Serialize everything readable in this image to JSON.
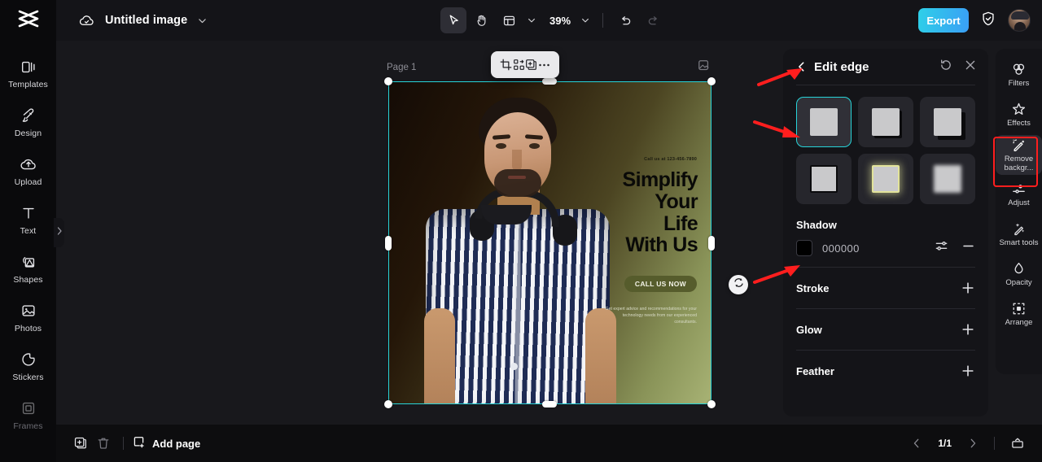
{
  "app": {
    "logo_icon": "capcut-logo-icon",
    "cloud_icon": "cloud-saved-icon",
    "document_title": "Untitled image",
    "title_caret_icon": "chevron-down-icon"
  },
  "toolbar": {
    "select_tool_icon": "cursor-arrow-icon",
    "hand_tool_icon": "hand-pan-icon",
    "layout_tool_icon": "layout-panel-icon",
    "layout_caret_icon": "chevron-down-icon",
    "zoom_level": "39%",
    "zoom_caret_icon": "chevron-down-icon",
    "undo_icon": "undo-arrow-icon",
    "redo_icon": "redo-arrow-icon",
    "export_label": "Export",
    "shield_icon": "shield-check-icon",
    "avatar_icon": "user-avatar"
  },
  "left_rail": {
    "items": [
      {
        "label": "Templates",
        "icon": "templates-icon",
        "dim": false
      },
      {
        "label": "Design",
        "icon": "design-brush-icon",
        "dim": false
      },
      {
        "label": "Upload",
        "icon": "upload-cloud-icon",
        "dim": false
      },
      {
        "label": "Text",
        "icon": "text-t-icon",
        "dim": false
      },
      {
        "label": "Shapes",
        "icon": "shapes-icon",
        "dim": false
      },
      {
        "label": "Photos",
        "icon": "photo-image-icon",
        "dim": false
      },
      {
        "label": "Stickers",
        "icon": "sticker-icon",
        "dim": false
      },
      {
        "label": "Frames",
        "icon": "frame-icon",
        "dim": true
      }
    ],
    "expander_icon": "chevron-right-icon"
  },
  "canvas": {
    "page_label": "Page 1",
    "float_toolbar": {
      "crop_icon": "crop-icon",
      "replace_icon": "replace-swap-icon",
      "duplicate_icon": "duplicate-add-icon",
      "more_icon": "more-horizontal-icon"
    },
    "layer_badge_icon": "layers-image-icon",
    "rotate_handle_icon": "rotate-icon",
    "poster": {
      "phone_text": "Call us at 123-456-7890",
      "headline_lines": [
        "Simplify",
        "Your",
        "Life",
        "With Us"
      ],
      "cta_label": "CALL US NOW",
      "paragraph": "Get expert advice and recommendations for your technology needs from our experienced consultants."
    }
  },
  "edit_panel": {
    "back_icon": "chevron-left-icon",
    "title": "Edit edge",
    "reset_icon": "reset-history-icon",
    "close_icon": "close-x-icon",
    "styles": [
      {
        "name": "style-none",
        "variant": "plain",
        "selected": true
      },
      {
        "name": "style-shadow-soft",
        "variant": "shadow-sm",
        "selected": false
      },
      {
        "name": "style-shadow-hard",
        "variant": "shadow-lg",
        "selected": false
      },
      {
        "name": "style-outline",
        "variant": "outline",
        "selected": false
      },
      {
        "name": "style-glow",
        "variant": "glow",
        "selected": false
      },
      {
        "name": "style-blur",
        "variant": "blur",
        "selected": false
      }
    ],
    "shadow": {
      "section_label": "Shadow",
      "color_hex": "000000",
      "color_swatch": "#000000",
      "settings_icon": "sliders-settings-icon",
      "remove_icon": "minus-icon"
    },
    "properties": [
      {
        "label": "Stroke",
        "action_icon": "plus-icon"
      },
      {
        "label": "Glow",
        "action_icon": "plus-icon"
      },
      {
        "label": "Feather",
        "action_icon": "plus-icon"
      }
    ]
  },
  "right_rail": {
    "items": [
      {
        "label": "Filters",
        "icon": "filters-circles-icon",
        "highlighted": false
      },
      {
        "label": "Effects",
        "icon": "effects-star-icon",
        "highlighted": false
      },
      {
        "label": "Remove backgr...",
        "icon": "remove-background-wand-icon",
        "highlighted": true
      },
      {
        "label": "Adjust",
        "icon": "adjust-sliders-icon",
        "highlighted": false
      },
      {
        "label": "Smart tools",
        "icon": "smart-tools-wand-icon",
        "highlighted": false
      },
      {
        "label": "Opacity",
        "icon": "opacity-drop-icon",
        "highlighted": false
      },
      {
        "label": "Arrange",
        "icon": "arrange-frame-icon",
        "highlighted": false
      }
    ]
  },
  "bottom_bar": {
    "duplicate_page_icon": "duplicate-page-icon",
    "delete_page_icon": "trash-delete-icon",
    "add_page_icon": "add-page-icon",
    "add_page_label": "Add page",
    "prev_icon": "chevron-left-icon",
    "page_indicator": "1/1",
    "next_icon": "chevron-right-icon",
    "present_icon": "present-screen-icon"
  },
  "annotations": {
    "accent_red": "#ff1e1e",
    "accent_cyan": "#27d4d9",
    "accent_blue": "#3a9ef5"
  }
}
